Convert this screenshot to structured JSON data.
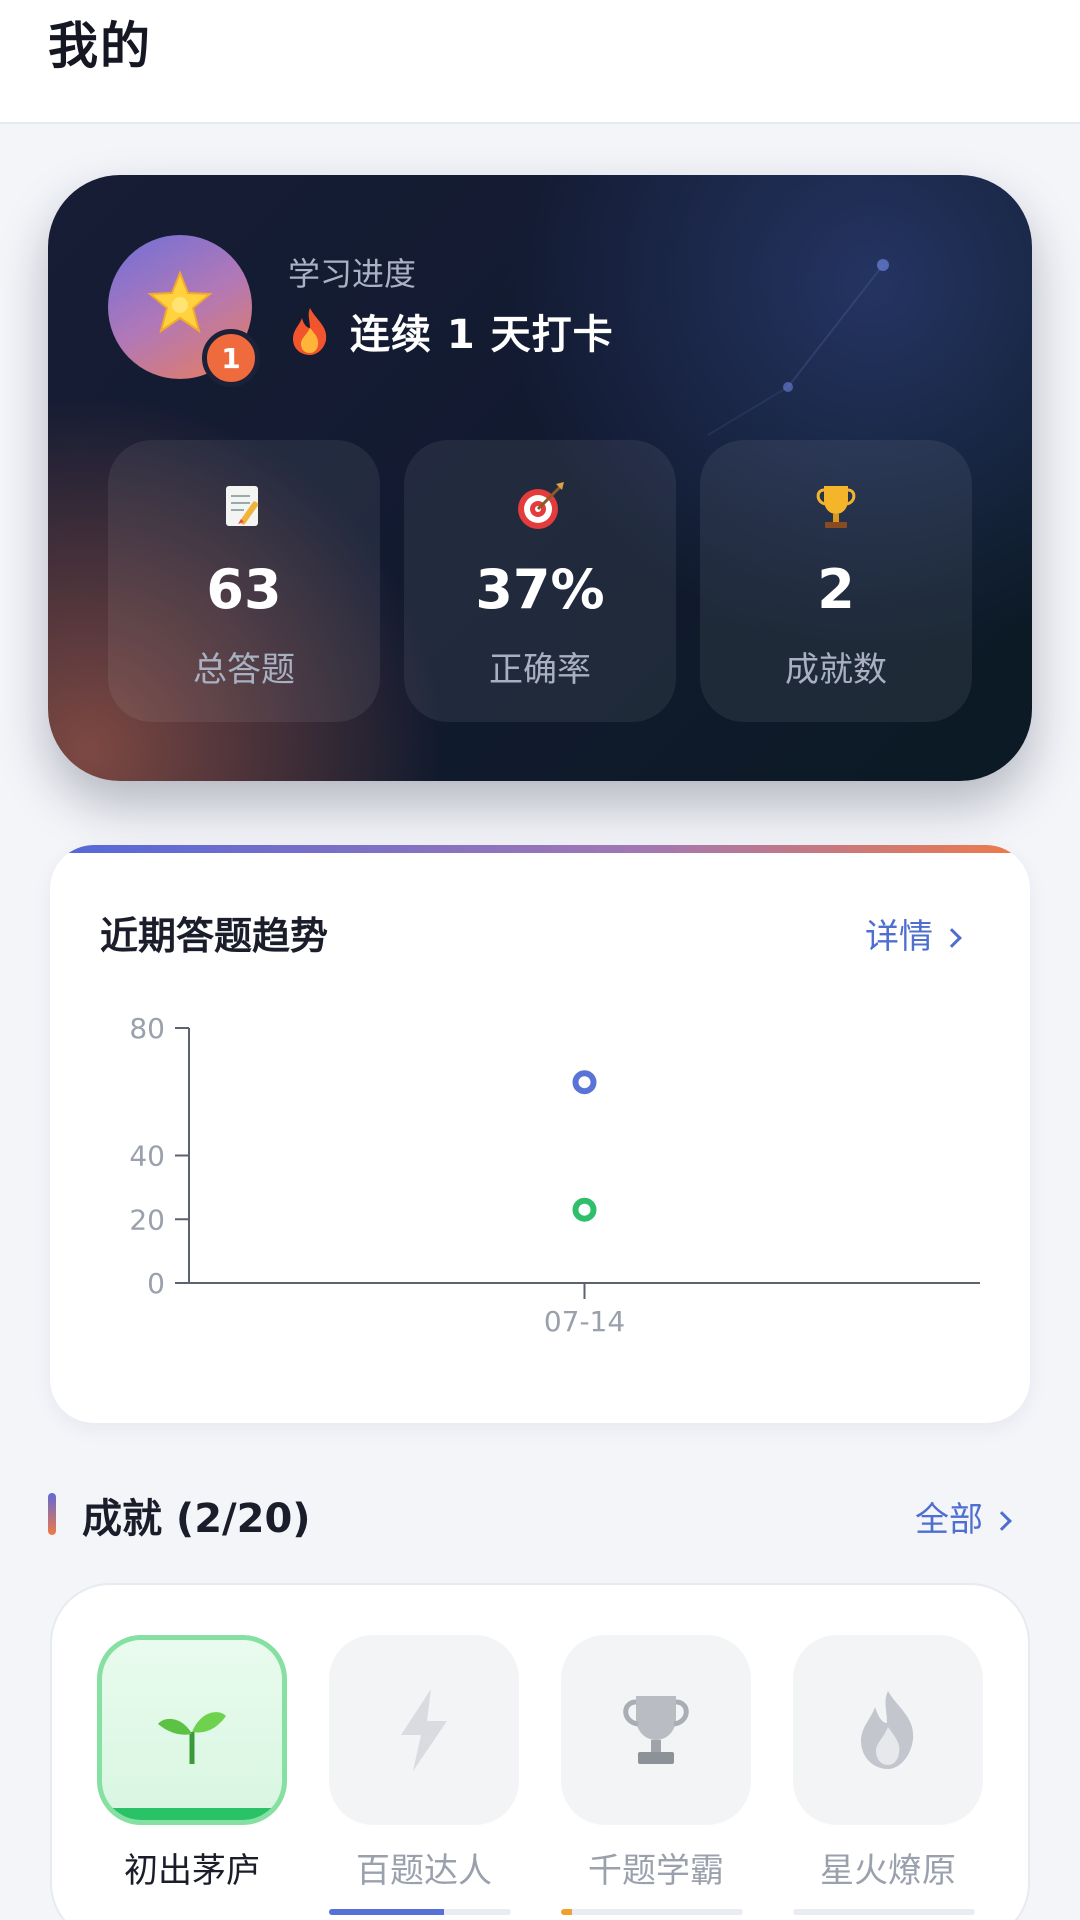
{
  "header": {
    "title": "我的"
  },
  "profile": {
    "avatar_icon": "star-icon",
    "badge_count": "1",
    "subtitle": "学习进度",
    "streak_icon": "flame-icon",
    "streak_text": "连续 1 天打卡"
  },
  "stats": [
    {
      "icon": "memo-icon",
      "value": "63",
      "label": "总答题"
    },
    {
      "icon": "target-icon",
      "value": "37%",
      "label": "正确率"
    },
    {
      "icon": "trophy-icon",
      "value": "2",
      "label": "成就数"
    }
  ],
  "trend": {
    "title": "近期答题趋势",
    "detail_label": "详情"
  },
  "chart_data": {
    "type": "scatter",
    "title": "",
    "xlabel": "",
    "ylabel": "",
    "categories": [
      "07-14"
    ],
    "y_ticks": [
      "0",
      "20",
      "40",
      "80"
    ],
    "ylim": [
      0,
      80
    ],
    "grid": false,
    "series": [
      {
        "values": [
          63
        ],
        "color": "#5a73d6"
      },
      {
        "values": [
          23
        ],
        "color": "#2fbf6b"
      }
    ]
  },
  "achievements": {
    "title": "成就 (2/20)",
    "all_label": "全部",
    "items": [
      {
        "name": "初出茅庐",
        "icon": "seedling-icon",
        "unlocked": true,
        "progress": 1.0
      },
      {
        "name": "百题达人",
        "icon": "lightning-icon",
        "unlocked": false,
        "progress": 0.63
      },
      {
        "name": "千题学霸",
        "icon": "trophy-icon",
        "unlocked": false,
        "progress": 0.06
      },
      {
        "name": "星火燎原",
        "icon": "fire-icon",
        "unlocked": false,
        "progress": 0.0
      }
    ]
  },
  "colors": {
    "accent": "#4e6fd0",
    "success": "#29c267",
    "badge": "#ef6a3c"
  }
}
